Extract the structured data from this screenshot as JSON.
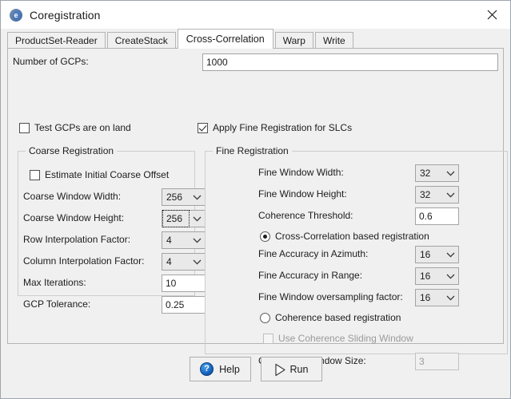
{
  "window": {
    "title": "Coregistration",
    "app_icon": "globe-icon",
    "close_icon": "close-icon"
  },
  "tabs": [
    {
      "label": "ProductSet-Reader",
      "selected": false
    },
    {
      "label": "CreateStack",
      "selected": false
    },
    {
      "label": "Cross-Correlation",
      "selected": true
    },
    {
      "label": "Warp",
      "selected": false
    },
    {
      "label": "Write",
      "selected": false
    }
  ],
  "gcp": {
    "label": "Number of GCPs:",
    "value": "1000",
    "test_on_land_label": "Test GCPs are on land",
    "test_on_land_checked": false,
    "apply_fine_label": "Apply Fine Registration for SLCs",
    "apply_fine_checked": true
  },
  "coarse": {
    "legend": "Coarse Registration",
    "estimate_offset_label": "Estimate Initial Coarse Offset",
    "estimate_offset_checked": false,
    "fields": [
      {
        "label": "Coarse Window Width:",
        "value": "256",
        "kind": "combo",
        "focused": false
      },
      {
        "label": "Coarse Window Height:",
        "value": "256",
        "kind": "combo",
        "focused": true
      },
      {
        "label": "Row Interpolation Factor:",
        "value": "4",
        "kind": "combo",
        "focused": false
      },
      {
        "label": "Column Interpolation Factor:",
        "value": "4",
        "kind": "combo",
        "focused": false
      },
      {
        "label": "Max Iterations:",
        "value": "10",
        "kind": "text",
        "focused": false
      },
      {
        "label": "GCP Tolerance:",
        "value": "0.25",
        "kind": "text",
        "focused": false
      }
    ]
  },
  "fine": {
    "legend": "Fine Registration",
    "window_width": {
      "label": "Fine Window Width:",
      "value": "32"
    },
    "window_height": {
      "label": "Fine Window Height:",
      "value": "32"
    },
    "coherence_threshold": {
      "label": "Coherence Threshold:",
      "value": "0.6"
    },
    "radio_cross_correlation": {
      "label": "Cross-Correlation based registration",
      "selected": true
    },
    "accuracy_azimuth": {
      "label": "Fine Accuracy in Azimuth:",
      "value": "16"
    },
    "accuracy_range": {
      "label": "Fine Accuracy in Range:",
      "value": "16"
    },
    "oversampling": {
      "label": "Fine Window oversampling factor:",
      "value": "16"
    },
    "radio_coherence": {
      "label": "Coherence based registration",
      "selected": false
    },
    "sliding_window": {
      "label": "Use Coherence Sliding Window",
      "checked": false,
      "disabled": true
    },
    "coherence_window_size": {
      "label": "Coherence Window Size:",
      "value": "3",
      "disabled": true
    }
  },
  "buttons": {
    "help": "Help",
    "run": "Run",
    "help_icon": "question-mark-icon",
    "run_icon": "play-icon"
  }
}
